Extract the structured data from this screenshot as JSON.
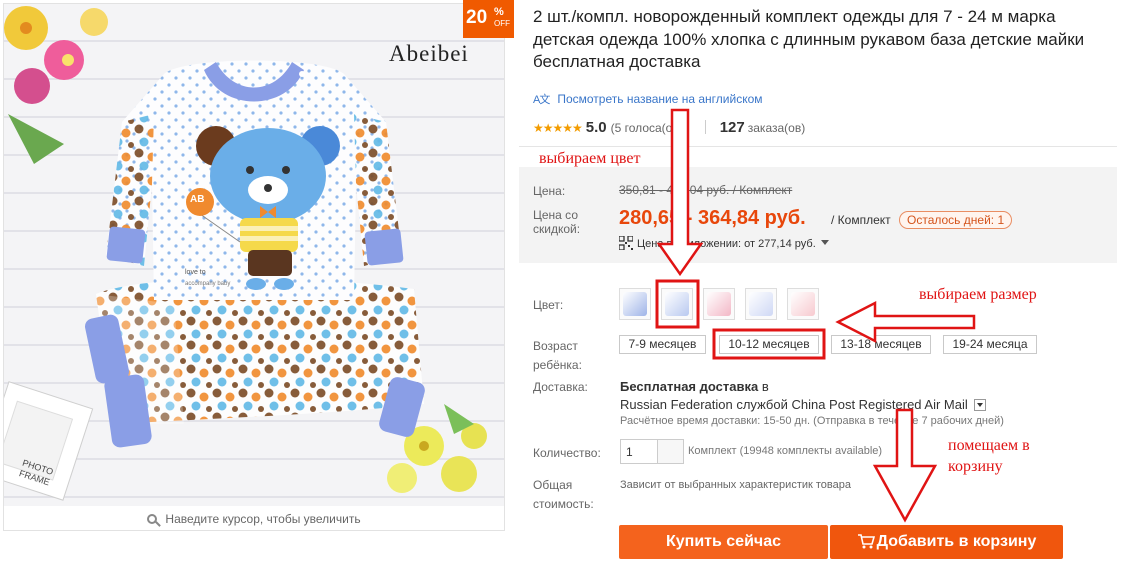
{
  "gallery": {
    "brand_watermark": "Abeibei",
    "badge": {
      "value": "20",
      "percent": "%",
      "off": "OFF"
    },
    "shirt_label": "AB",
    "shirt_tag": "love to",
    "shirt_tag2": "accompany baby",
    "frame_text": "PHOTO FRAME",
    "zoom_hint": "Наведите курсор, чтобы увеличить"
  },
  "product": {
    "title": "2 шт./компл. новорожденный комплект одежды для 7 - 24 м марка детская одежда 100% хлопка с длинным рукавом база детские майки бесплатная доставка",
    "translate_icon": "A文",
    "translate_link": "Посмотреть название на английском",
    "stars": "★★★★★",
    "rating": "5.0",
    "votes": "(5 голоса(ов))",
    "orders_count": "127",
    "orders_label": "заказа(ов)"
  },
  "price": {
    "label_price": "Цена:",
    "old_price": "350,81 - 456,04 руб. / Комплект",
    "label_discount_1": "Цена со",
    "label_discount_2": "скидкой:",
    "new_price": "280,65 - 364,84 руб.",
    "per_set": "/ Комплект",
    "days_left": "Осталось дней: 1",
    "app_price": "Цена в приложении: от 277,14 руб."
  },
  "options": {
    "color_label": "Цвет:",
    "colors": [
      "#9fb4e8",
      "#b9c9f0",
      "#f3b7c6",
      "#cfd8f5",
      "#f7c9cf"
    ],
    "age_label_1": "Возраст",
    "age_label_2": "ребёнка:",
    "sizes": [
      "7-9 месяцев",
      "10-12 месяцев",
      "13-18 месяцев",
      "19-24 месяца"
    ]
  },
  "shipping": {
    "label": "Доставка:",
    "free": "Бесплатная доставка",
    "to": "в",
    "method": "Russian Federation службой China Post Registered Air Mail",
    "time": "Расчётное время доставки: 15-50 дн. (Отправка в течение 7 рабочих дней)"
  },
  "quantity": {
    "label": "Количество:",
    "value": "1",
    "available": "Комплект (19948 комплекты available)"
  },
  "total": {
    "label_1": "Общая",
    "label_2": "стоимость:",
    "value": "Зависит от выбранных характеристик товара"
  },
  "buttons": {
    "buy_now": "Купить сейчас",
    "add_to_cart": "Добавить в корзину"
  },
  "annotations": {
    "choose_color": "выбираем цвет",
    "choose_size": "выбираем размер",
    "to_cart_1": "помещаем в",
    "to_cart_2": "корзину"
  },
  "colors": {
    "accent": "#f4631d",
    "price": "#e8470b",
    "annotation": "#e01414",
    "link": "#3a76c9"
  }
}
